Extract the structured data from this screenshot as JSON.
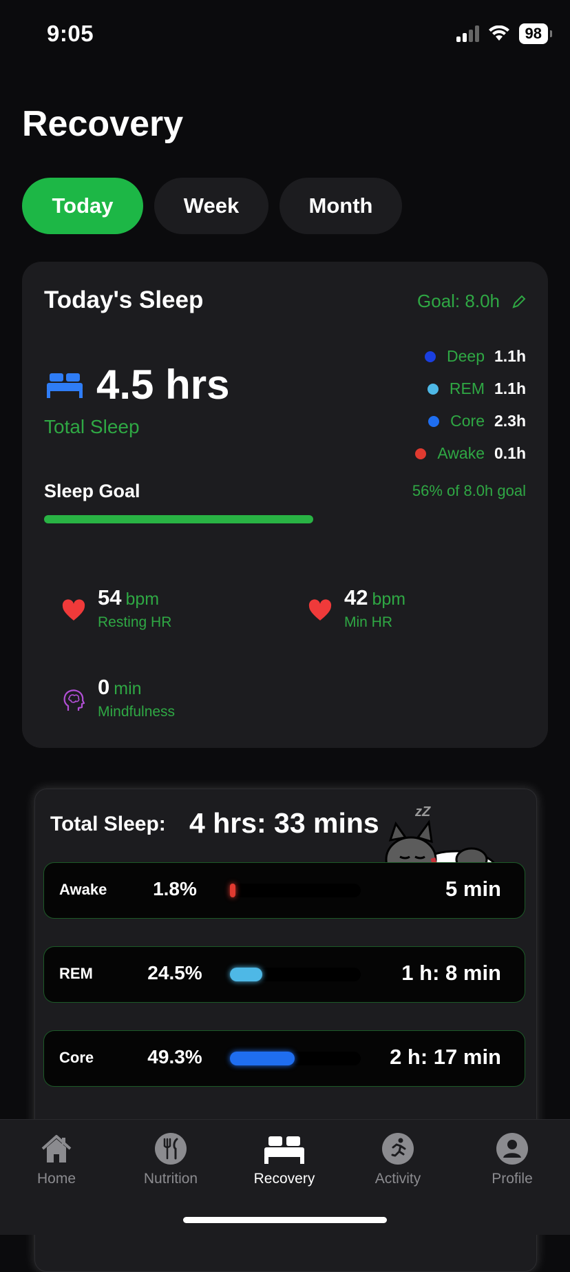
{
  "status_bar": {
    "time": "9:05",
    "battery": "98"
  },
  "page_title": "Recovery",
  "tabs": [
    {
      "label": "Today",
      "active": true
    },
    {
      "label": "Week",
      "active": false
    },
    {
      "label": "Month",
      "active": false
    }
  ],
  "sleep_card": {
    "title": "Today's Sleep",
    "goal_label": "Goal: 8.0h",
    "total_value": "4.5 hrs",
    "total_label": "Total Sleep",
    "legend": [
      {
        "name": "Deep",
        "value": "1.1h",
        "color": "#1a3fe0"
      },
      {
        "name": "REM",
        "value": "1.1h",
        "color": "#4eb8e6"
      },
      {
        "name": "Core",
        "value": "2.3h",
        "color": "#1f6ef0"
      },
      {
        "name": "Awake",
        "value": "0.1h",
        "color": "#e03a30"
      }
    ],
    "sleep_goal_label": "Sleep Goal",
    "sleep_goal_pct_text": "56% of 8.0h goal",
    "sleep_goal_progress": 0.56,
    "metrics": {
      "resting_hr": {
        "value": "54",
        "unit": "bpm",
        "label": "Resting HR"
      },
      "min_hr": {
        "value": "42",
        "unit": "bpm",
        "label": "Min HR"
      },
      "mindfulness": {
        "value": "0",
        "unit": "min",
        "label": "Mindfulness"
      }
    }
  },
  "breakdown_card": {
    "title": "Total Sleep:",
    "value": "4 hrs: 33 mins",
    "zzz": "zZ",
    "stages": [
      {
        "name": "Awake",
        "pct": "1.8%",
        "fraction": 0.018,
        "duration": "5 min",
        "color": "#e03a30"
      },
      {
        "name": "REM",
        "pct": "24.5%",
        "fraction": 0.245,
        "duration": "1 h: 8 min",
        "color": "#4eb8e6"
      },
      {
        "name": "Core",
        "pct": "49.3%",
        "fraction": 0.493,
        "duration": "2 h: 17 min",
        "color": "#1f6ef0"
      }
    ]
  },
  "tabbar": {
    "items": [
      {
        "label": "Home",
        "icon": "house-icon"
      },
      {
        "label": "Nutrition",
        "icon": "fork-knife-icon"
      },
      {
        "label": "Recovery",
        "icon": "bed-icon"
      },
      {
        "label": "Activity",
        "icon": "running-icon"
      },
      {
        "label": "Profile",
        "icon": "person-icon"
      }
    ]
  },
  "colors": {
    "accent": "#1db746",
    "accent_text": "#2fa844",
    "card_bg": "#1c1c1f",
    "heart": "#f03a3a",
    "mind": "#b24fd6"
  }
}
